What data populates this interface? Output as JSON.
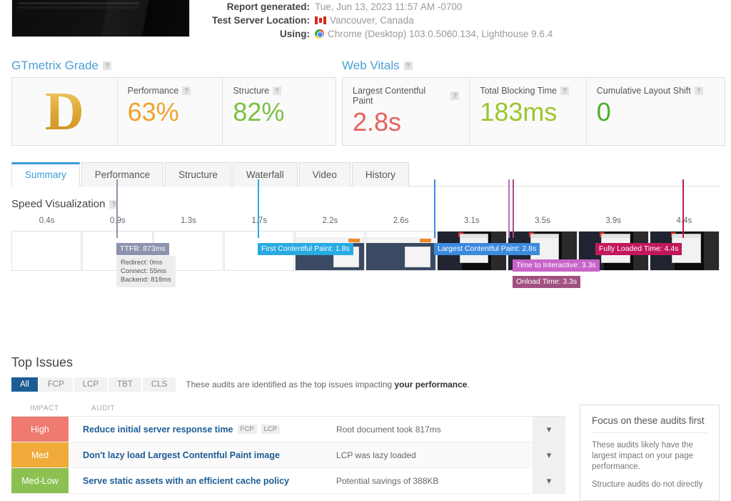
{
  "header": {
    "rows": [
      {
        "label": "Report generated:",
        "value": "Tue, Jun 13, 2023 11:57 AM -0700",
        "icon": ""
      },
      {
        "label": "Test Server Location:",
        "value": "Vancouver, Canada",
        "icon": "flag-canada-icon"
      },
      {
        "label": "Using:",
        "value": "Chrome (Desktop) 103.0.5060.134, Lighthouse 9.6.4",
        "icon": "chrome-icon"
      }
    ]
  },
  "gtmetrix_grade": {
    "title": "GTmetrix Grade",
    "help": "?",
    "grade": "D",
    "metrics": [
      {
        "label": "Performance",
        "help": "?",
        "value": "63%",
        "color": "#efa32a"
      },
      {
        "label": "Structure",
        "help": "?",
        "value": "82%",
        "color": "#7bc043"
      }
    ]
  },
  "web_vitals": {
    "title": "Web Vitals",
    "help": "?",
    "metrics": [
      {
        "label": "Largest Contentful Paint",
        "help": "?",
        "value": "2.8s",
        "color": "#e8615a"
      },
      {
        "label": "Total Blocking Time",
        "help": "?",
        "value": "183ms",
        "color": "#9ac62e"
      },
      {
        "label": "Cumulative Layout Shift",
        "help": "?",
        "value": "0",
        "color": "#4caf2f"
      }
    ]
  },
  "tabs": [
    {
      "label": "Summary",
      "active": true
    },
    {
      "label": "Performance",
      "active": false
    },
    {
      "label": "Structure",
      "active": false
    },
    {
      "label": "Waterfall",
      "active": false
    },
    {
      "label": "Video",
      "active": false
    },
    {
      "label": "History",
      "active": false
    }
  ],
  "speed_visualization": {
    "title": "Speed Visualization",
    "help": "?",
    "ticks": [
      "0.4s",
      "0.9s",
      "1.3s",
      "1.7s",
      "2.2s",
      "2.6s",
      "3.1s",
      "3.5s",
      "3.9s",
      "4.4s"
    ],
    "events": [
      {
        "name": "ttfb",
        "label": "TTFB: 873ms",
        "color": "#8d93ae"
      },
      {
        "name": "fcp",
        "label": "First Contentful Paint: 1.8s",
        "color": "#29abe2"
      },
      {
        "name": "lcp",
        "label": "Largest Contentful Paint: 2.8s",
        "color": "#3c8ade"
      },
      {
        "name": "tti",
        "label": "Time to Interactive: 3.3s",
        "color": "#c963c9"
      },
      {
        "name": "onload",
        "label": "Onload Time: 3.3s",
        "color": "#a0517f"
      },
      {
        "name": "fully",
        "label": "Fully Loaded Time: 4.4s",
        "color": "#c2185b"
      }
    ],
    "ttfb_breakdown": [
      "Redirect: 0ms",
      "Connect: 55ms",
      "Backend: 818ms"
    ]
  },
  "top_issues": {
    "title": "Top Issues",
    "filters": [
      {
        "label": "All",
        "active": true
      },
      {
        "label": "FCP",
        "active": false
      },
      {
        "label": "LCP",
        "active": false
      },
      {
        "label": "TBT",
        "active": false
      },
      {
        "label": "CLS",
        "active": false
      }
    ],
    "note_prefix": "These audits are identified as the top issues impacting ",
    "note_bold": "your performance",
    "note_suffix": ".",
    "columns": {
      "impact": "IMPACT",
      "audit": "AUDIT"
    },
    "rows": [
      {
        "impact": "High",
        "impact_class": "imp-high",
        "audit": "Reduce initial server response time",
        "tags": [
          "FCP",
          "LCP"
        ],
        "description": "Root document took 817ms",
        "chevron": "chevron-down-icon"
      },
      {
        "impact": "Med",
        "impact_class": "imp-med",
        "audit": "Don't lazy load Largest Contentful Paint image",
        "tags": [],
        "description": "LCP was lazy loaded",
        "chevron": "chevron-down-icon"
      },
      {
        "impact": "Med-Low",
        "impact_class": "imp-medlow",
        "audit": "Serve static assets with an efficient cache policy",
        "tags": [],
        "description": "Potential savings of 388KB",
        "chevron": "chevron-down-icon"
      }
    ],
    "sidebar": {
      "title": "Focus on these audits first",
      "paragraph1": "These audits likely have the largest impact on your page performance.",
      "paragraph2": "Structure audits do not directly"
    }
  }
}
